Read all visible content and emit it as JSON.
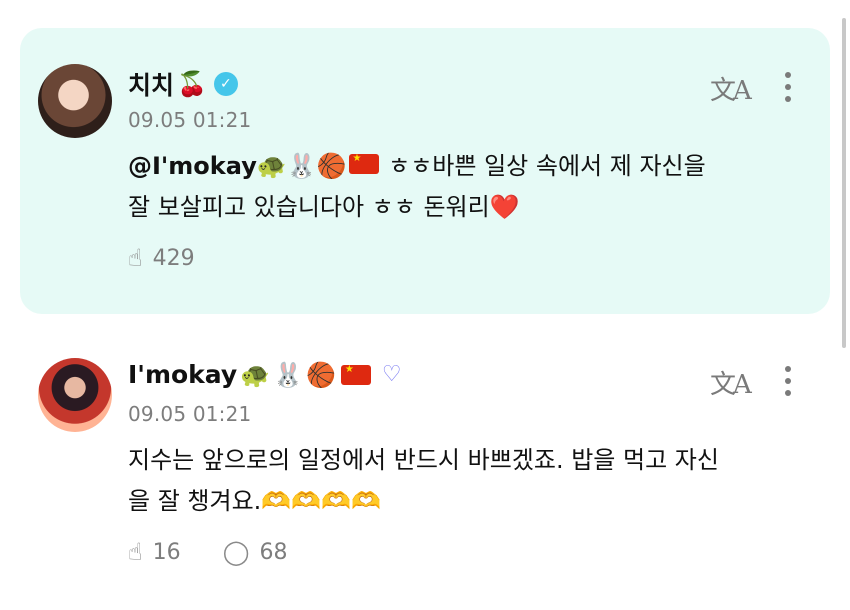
{
  "posts": [
    {
      "author": "치치",
      "author_emoji": "🍒",
      "badge": "verified",
      "date": "09.05 01:21",
      "mention": "@I'mokay",
      "mention_emojis": [
        "🐢",
        "🐰",
        "🏀"
      ],
      "text": " ㅎㅎ바쁜 일상 속에서 제 자신을 잘 보살피고 있습니다아 ㅎㅎ 돈워리",
      "trailing_emoji": "❤️",
      "likes": "429",
      "translate_icon": "translate-icon",
      "more_icon": "more-icon"
    },
    {
      "author": "I'mokay",
      "author_emojis": [
        "🐢",
        "🐰",
        "🏀"
      ],
      "badge": "heart",
      "date": "09.05 01:21",
      "text": "지수는 앞으로의 일정에서 반드시 바쁘겠죠. 밥을 먹고 자신을 잘 챙겨요.",
      "trailing_emojis": "🫶🫶🫶🫶",
      "likes": "16",
      "comments": "68"
    }
  ],
  "colors": {
    "highlight_bg": "#e6faf6",
    "verified": "#45c6ea",
    "heart_badge": "#7b7cf2",
    "muted": "#7d7d7d"
  }
}
